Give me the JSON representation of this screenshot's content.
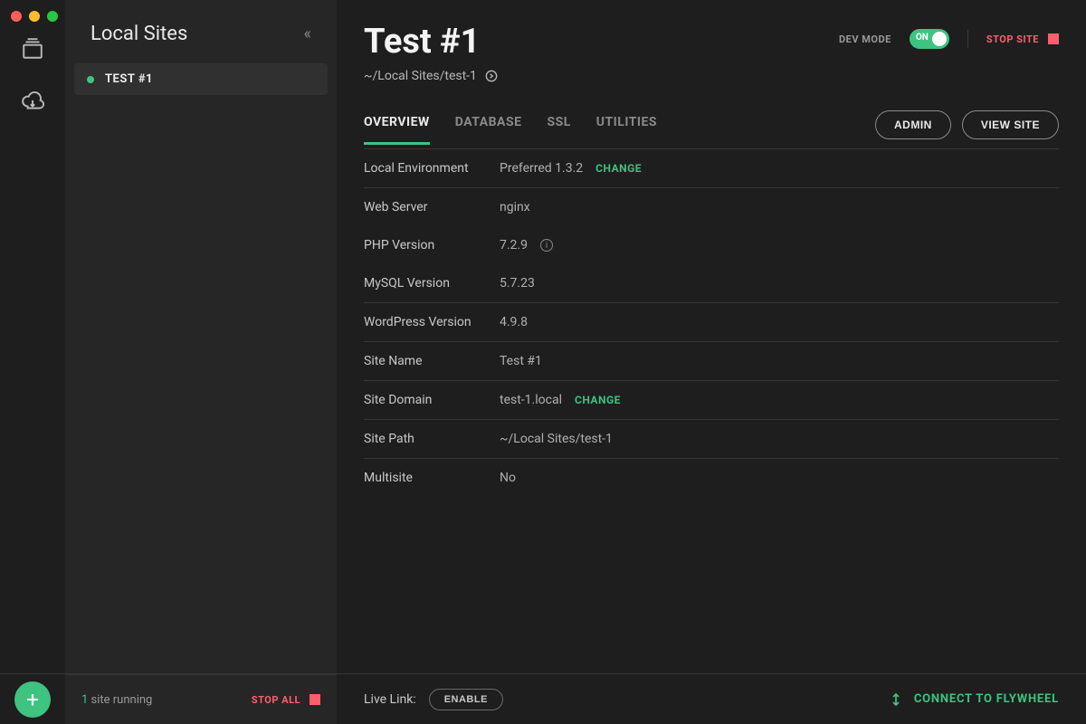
{
  "sidebar": {
    "title": "Local Sites",
    "site": {
      "label": "TEST #1"
    }
  },
  "header": {
    "siteTitle": "Test #1",
    "sitePath": "~/Local Sites/test-1",
    "devMode": "DEV MODE",
    "toggleOn": "ON",
    "stopSite": "STOP SITE"
  },
  "tabs": {
    "overview": "OVERVIEW",
    "database": "DATABASE",
    "ssl": "SSL",
    "utilities": "UTILITIES"
  },
  "buttons": {
    "admin": "ADMIN",
    "viewSite": "VIEW SITE",
    "change": "CHANGE",
    "enable": "ENABLE"
  },
  "overview": {
    "localEnvLabel": "Local Environment",
    "localEnvValue": "Preferred 1.3.2",
    "webServerLabel": "Web Server",
    "webServerValue": "nginx",
    "phpLabel": "PHP Version",
    "phpValue": "7.2.9",
    "mysqlLabel": "MySQL Version",
    "mysqlValue": "5.7.23",
    "wpLabel": "WordPress Version",
    "wpValue": "4.9.8",
    "siteNameLabel": "Site Name",
    "siteNameValue": "Test #1",
    "siteDomainLabel": "Site Domain",
    "siteDomainValue": "test-1.local",
    "sitePathLabel": "Site Path",
    "sitePathValue": "~/Local Sites/test-1",
    "multisiteLabel": "Multisite",
    "multisiteValue": "No"
  },
  "footer": {
    "runningCount": "1",
    "runningText": " site running",
    "stopAll": "STOP ALL",
    "liveLinkLabel": "Live Link:",
    "connect": "CONNECT TO FLYWHEEL"
  }
}
